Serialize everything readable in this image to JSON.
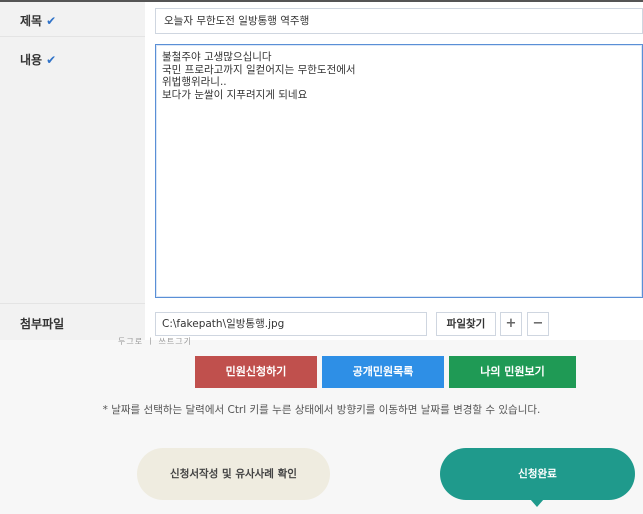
{
  "title_row": {
    "label": "제목",
    "check": "✔",
    "value": "오늘자 무한도전 일방통행 역주행"
  },
  "content_row": {
    "label": "내용",
    "check": "✔",
    "lines": [
      "불철주야 고생많으십니다",
      "국민 프로라고까지 일컫어지는 무한도전에서",
      "위법행위라니..",
      "보다가 눈쌀이 지푸려지게 되네요"
    ]
  },
  "attach_row": {
    "label": "첨부파일",
    "value": "C:\\fakepath\\일방통행.jpg",
    "find_label": "파일찾기",
    "plus_label": "+",
    "minus_label": "−",
    "partial_text": "두그로 ㅣ 쓰트그기"
  },
  "actions": {
    "apply_label": "민원신청하기",
    "public_list_label": "공개민원목록",
    "my_label": "나의 민원보기",
    "apply_color": "#c0504d",
    "public_color": "#2e8fe6",
    "my_color": "#1f9a55"
  },
  "note": "* 날짜를 선택하는 달력에서 Ctrl 키를 누른 상태에서 방향키를 이동하면 날짜를 변경할 수 있습니다.",
  "steps": {
    "step1_label": "신청서작성 및 유사사례 확인",
    "step2_label": "신청완료",
    "step1_color": "#efece0",
    "step2_color": "#1f9a8c"
  }
}
